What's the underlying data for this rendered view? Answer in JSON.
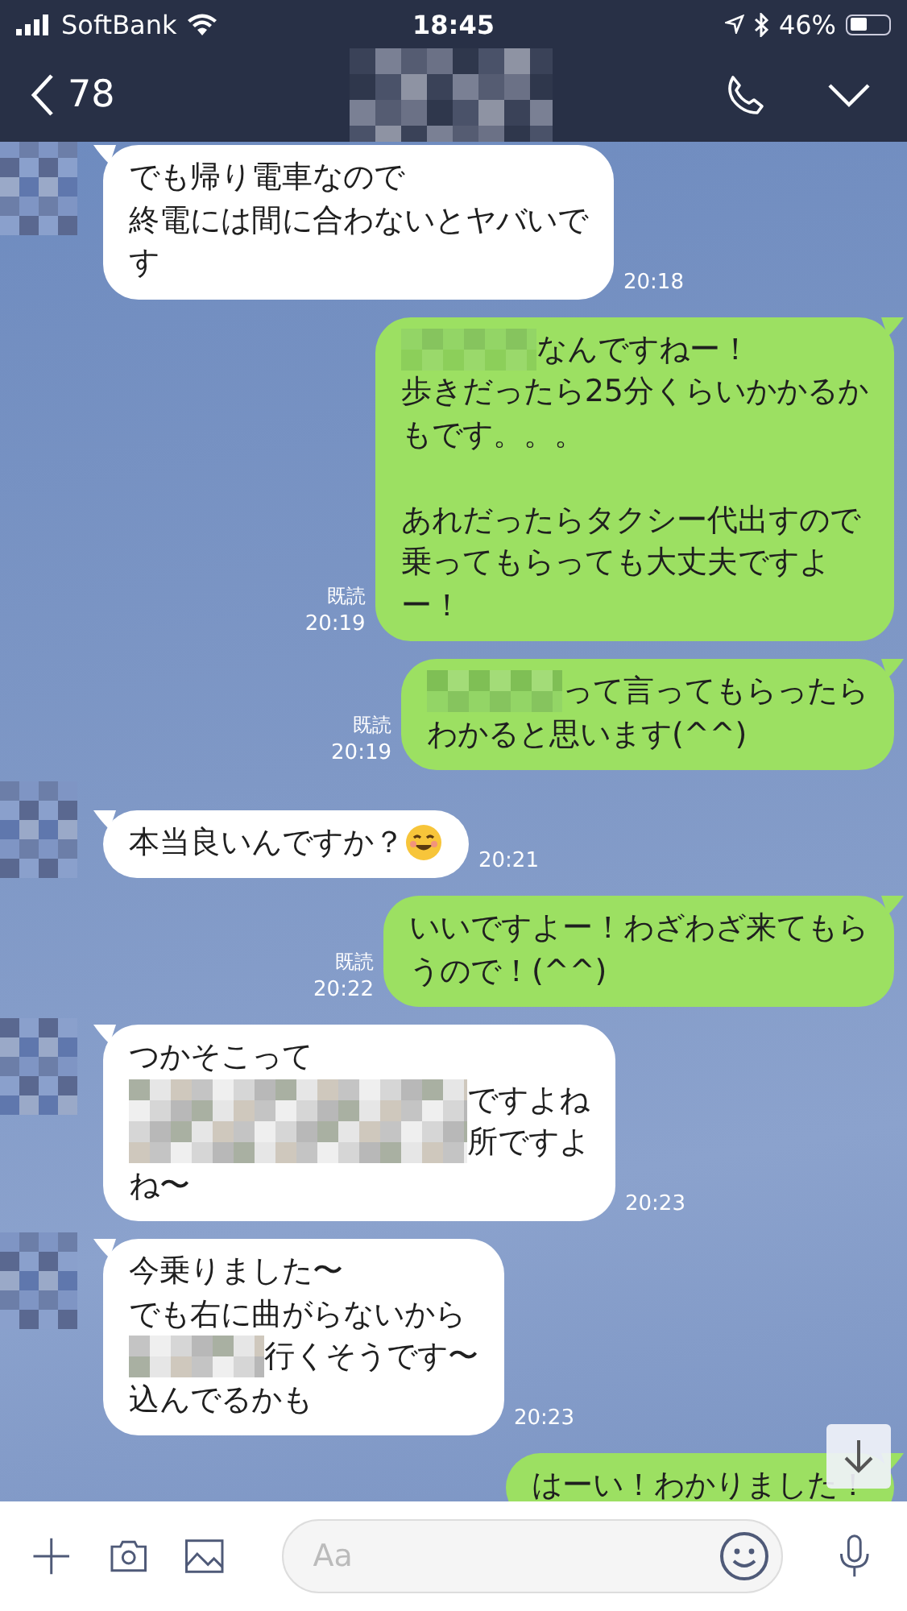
{
  "status_bar": {
    "carrier": "SoftBank",
    "time": "18:45",
    "battery_text": "46%",
    "battery": {
      "level": 0.46
    }
  },
  "header": {
    "back_count": "78",
    "title_redacted": true
  },
  "messages": [
    {
      "kind": "incoming",
      "avatar": true,
      "lines": [
        {
          "kind": "plain",
          "text": "でも帰り電車なので"
        },
        {
          "kind": "plain",
          "text": "終電には間に合わないとヤバいで"
        },
        {
          "kind": "plain",
          "text": "す"
        }
      ],
      "time": "20:18"
    },
    {
      "kind": "outgoing",
      "lines": [
        {
          "kind": "masked",
          "text": "なんですねー！"
        },
        {
          "kind": "plain",
          "text": "歩きだったら25分くらいかかるか"
        },
        {
          "kind": "plain",
          "text": "もです。。。"
        },
        {
          "kind": "blank"
        },
        {
          "kind": "plain",
          "text": "あれだったらタクシー代出すので"
        },
        {
          "kind": "plain",
          "text": "乗ってもらっても大丈夫ですよ"
        },
        {
          "kind": "plain",
          "text": "ー！"
        }
      ],
      "read": "既読",
      "time": "20:19"
    },
    {
      "kind": "outgoing",
      "lines": [
        {
          "kind": "masked",
          "text": "って言ってもらったら"
        },
        {
          "kind": "plain",
          "text": "わかると思います(^^)"
        }
      ],
      "read": "既読",
      "time": "20:19"
    },
    {
      "kind": "incoming",
      "avatar": true,
      "lines": [
        {
          "kind": "emoji",
          "text": "本当良いんですか？"
        }
      ],
      "time": "20:21"
    },
    {
      "kind": "outgoing",
      "lines": [
        {
          "kind": "plain",
          "text": "いいですよー！わざわざ来てもら"
        },
        {
          "kind": "plain",
          "text": "うので！(^^)"
        }
      ],
      "read": "既読",
      "time": "20:22"
    },
    {
      "kind": "incoming",
      "avatar": true,
      "lines": [
        {
          "kind": "plain",
          "text": "つかそこって"
        },
        {
          "kind": "widemasked",
          "text": "ですよね"
        },
        {
          "kind": "widemasked",
          "text": "所ですよ"
        },
        {
          "kind": "plain",
          "text": "ね〜"
        }
      ],
      "time": "20:23"
    },
    {
      "kind": "incoming",
      "avatar": true,
      "lines": [
        {
          "kind": "plain",
          "text": "今乗りました〜"
        },
        {
          "kind": "plain",
          "text": "でも右に曲がらないから"
        },
        {
          "kind": "masked",
          "text": "行くそうです〜"
        },
        {
          "kind": "plain",
          "text": "込んでるかも"
        }
      ],
      "time": "20:23"
    },
    {
      "kind": "outgoing",
      "lines": [
        {
          "kind": "plain",
          "text": "はーい！わかりました！"
        }
      ]
    }
  ],
  "input_bar": {
    "placeholder": "Aa"
  }
}
